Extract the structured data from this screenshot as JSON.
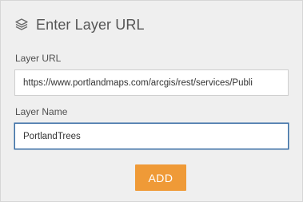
{
  "dialog": {
    "title": "Enter Layer URL",
    "icon": "layers-icon"
  },
  "form": {
    "url_label": "Layer URL",
    "url_value": "https://www.portlandmaps.com/arcgis/rest/services/Publi",
    "name_label": "Layer Name",
    "name_value": "PortlandTrees"
  },
  "actions": {
    "add_label": "ADD"
  },
  "colors": {
    "panel_background": "#efefef",
    "accent": "#ef9a37",
    "focus_border": "#3a6ea5"
  }
}
